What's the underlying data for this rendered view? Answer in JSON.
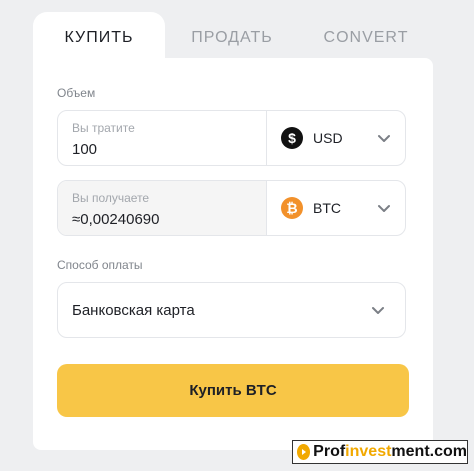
{
  "tabs": [
    {
      "label": "КУПИТЬ",
      "active": true
    },
    {
      "label": "ПРОДАТЬ",
      "active": false
    },
    {
      "label": "CONVERT",
      "active": false
    }
  ],
  "form": {
    "volume_label": "Объем",
    "spend": {
      "hint": "Вы тратите",
      "value": "100",
      "currency": "USD",
      "icon": "dollar-coin-icon"
    },
    "receive": {
      "hint": "Вы получаете",
      "value": "≈0,00240690",
      "currency": "BTC",
      "icon": "bitcoin-coin-icon"
    },
    "payment_label": "Способ оплаты",
    "payment_method": "Банковская карта",
    "submit_label": "Купить BTC"
  },
  "watermark": {
    "prefix": "Prof",
    "accent": "invest",
    "suffix": "ment.com"
  },
  "colors": {
    "accent": "#f8c647",
    "btc": "#f2912b",
    "usd": "#111111"
  }
}
